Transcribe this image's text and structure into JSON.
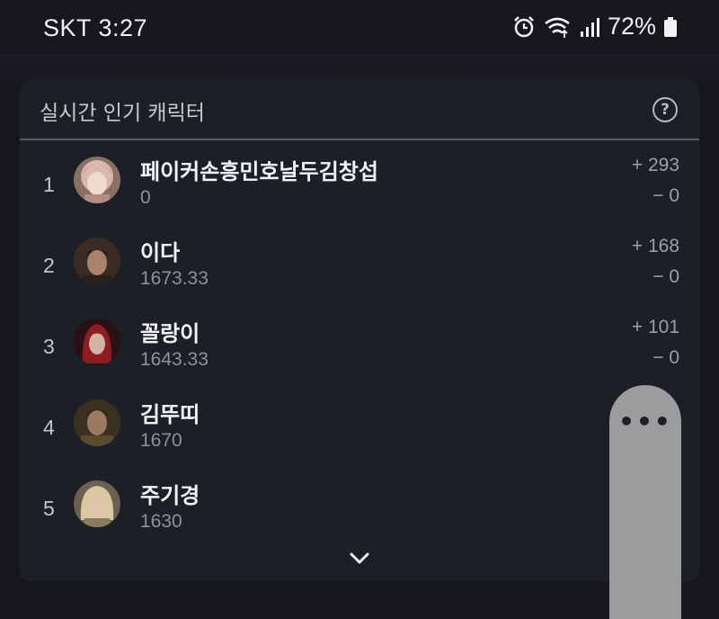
{
  "status_bar": {
    "carrier_time": "SKT 3:27",
    "battery": "72%",
    "icons": [
      "alarm-icon",
      "wifi-icon",
      "signal-icon",
      "battery-icon"
    ]
  },
  "panel": {
    "title": "실시간 인기 캐릭터",
    "help_icon": "?",
    "rows": [
      {
        "rank": "1",
        "name": "페이커손흥민호날두김창섭",
        "score": "0",
        "plus": "+ 293",
        "minus": "− 0",
        "avatar": "avatar-pink-hair"
      },
      {
        "rank": "2",
        "name": "이다",
        "score": "1673.33",
        "plus": "+ 168",
        "minus": "− 0",
        "avatar": "avatar-dark-hair"
      },
      {
        "rank": "3",
        "name": "꼴랑이",
        "score": "1643.33",
        "plus": "+ 101",
        "minus": "− 0",
        "avatar": "avatar-red-hair"
      },
      {
        "rank": "4",
        "name": "김뚜띠",
        "score": "1670",
        "plus": "",
        "minus": "",
        "avatar": "avatar-brown-hair"
      },
      {
        "rank": "5",
        "name": "주기경",
        "score": "1630",
        "plus": "",
        "minus": "",
        "avatar": "avatar-blonde-hair"
      }
    ],
    "expand_icon": "chevron-down-icon"
  },
  "overlay": {
    "handle_dots": "•••"
  }
}
